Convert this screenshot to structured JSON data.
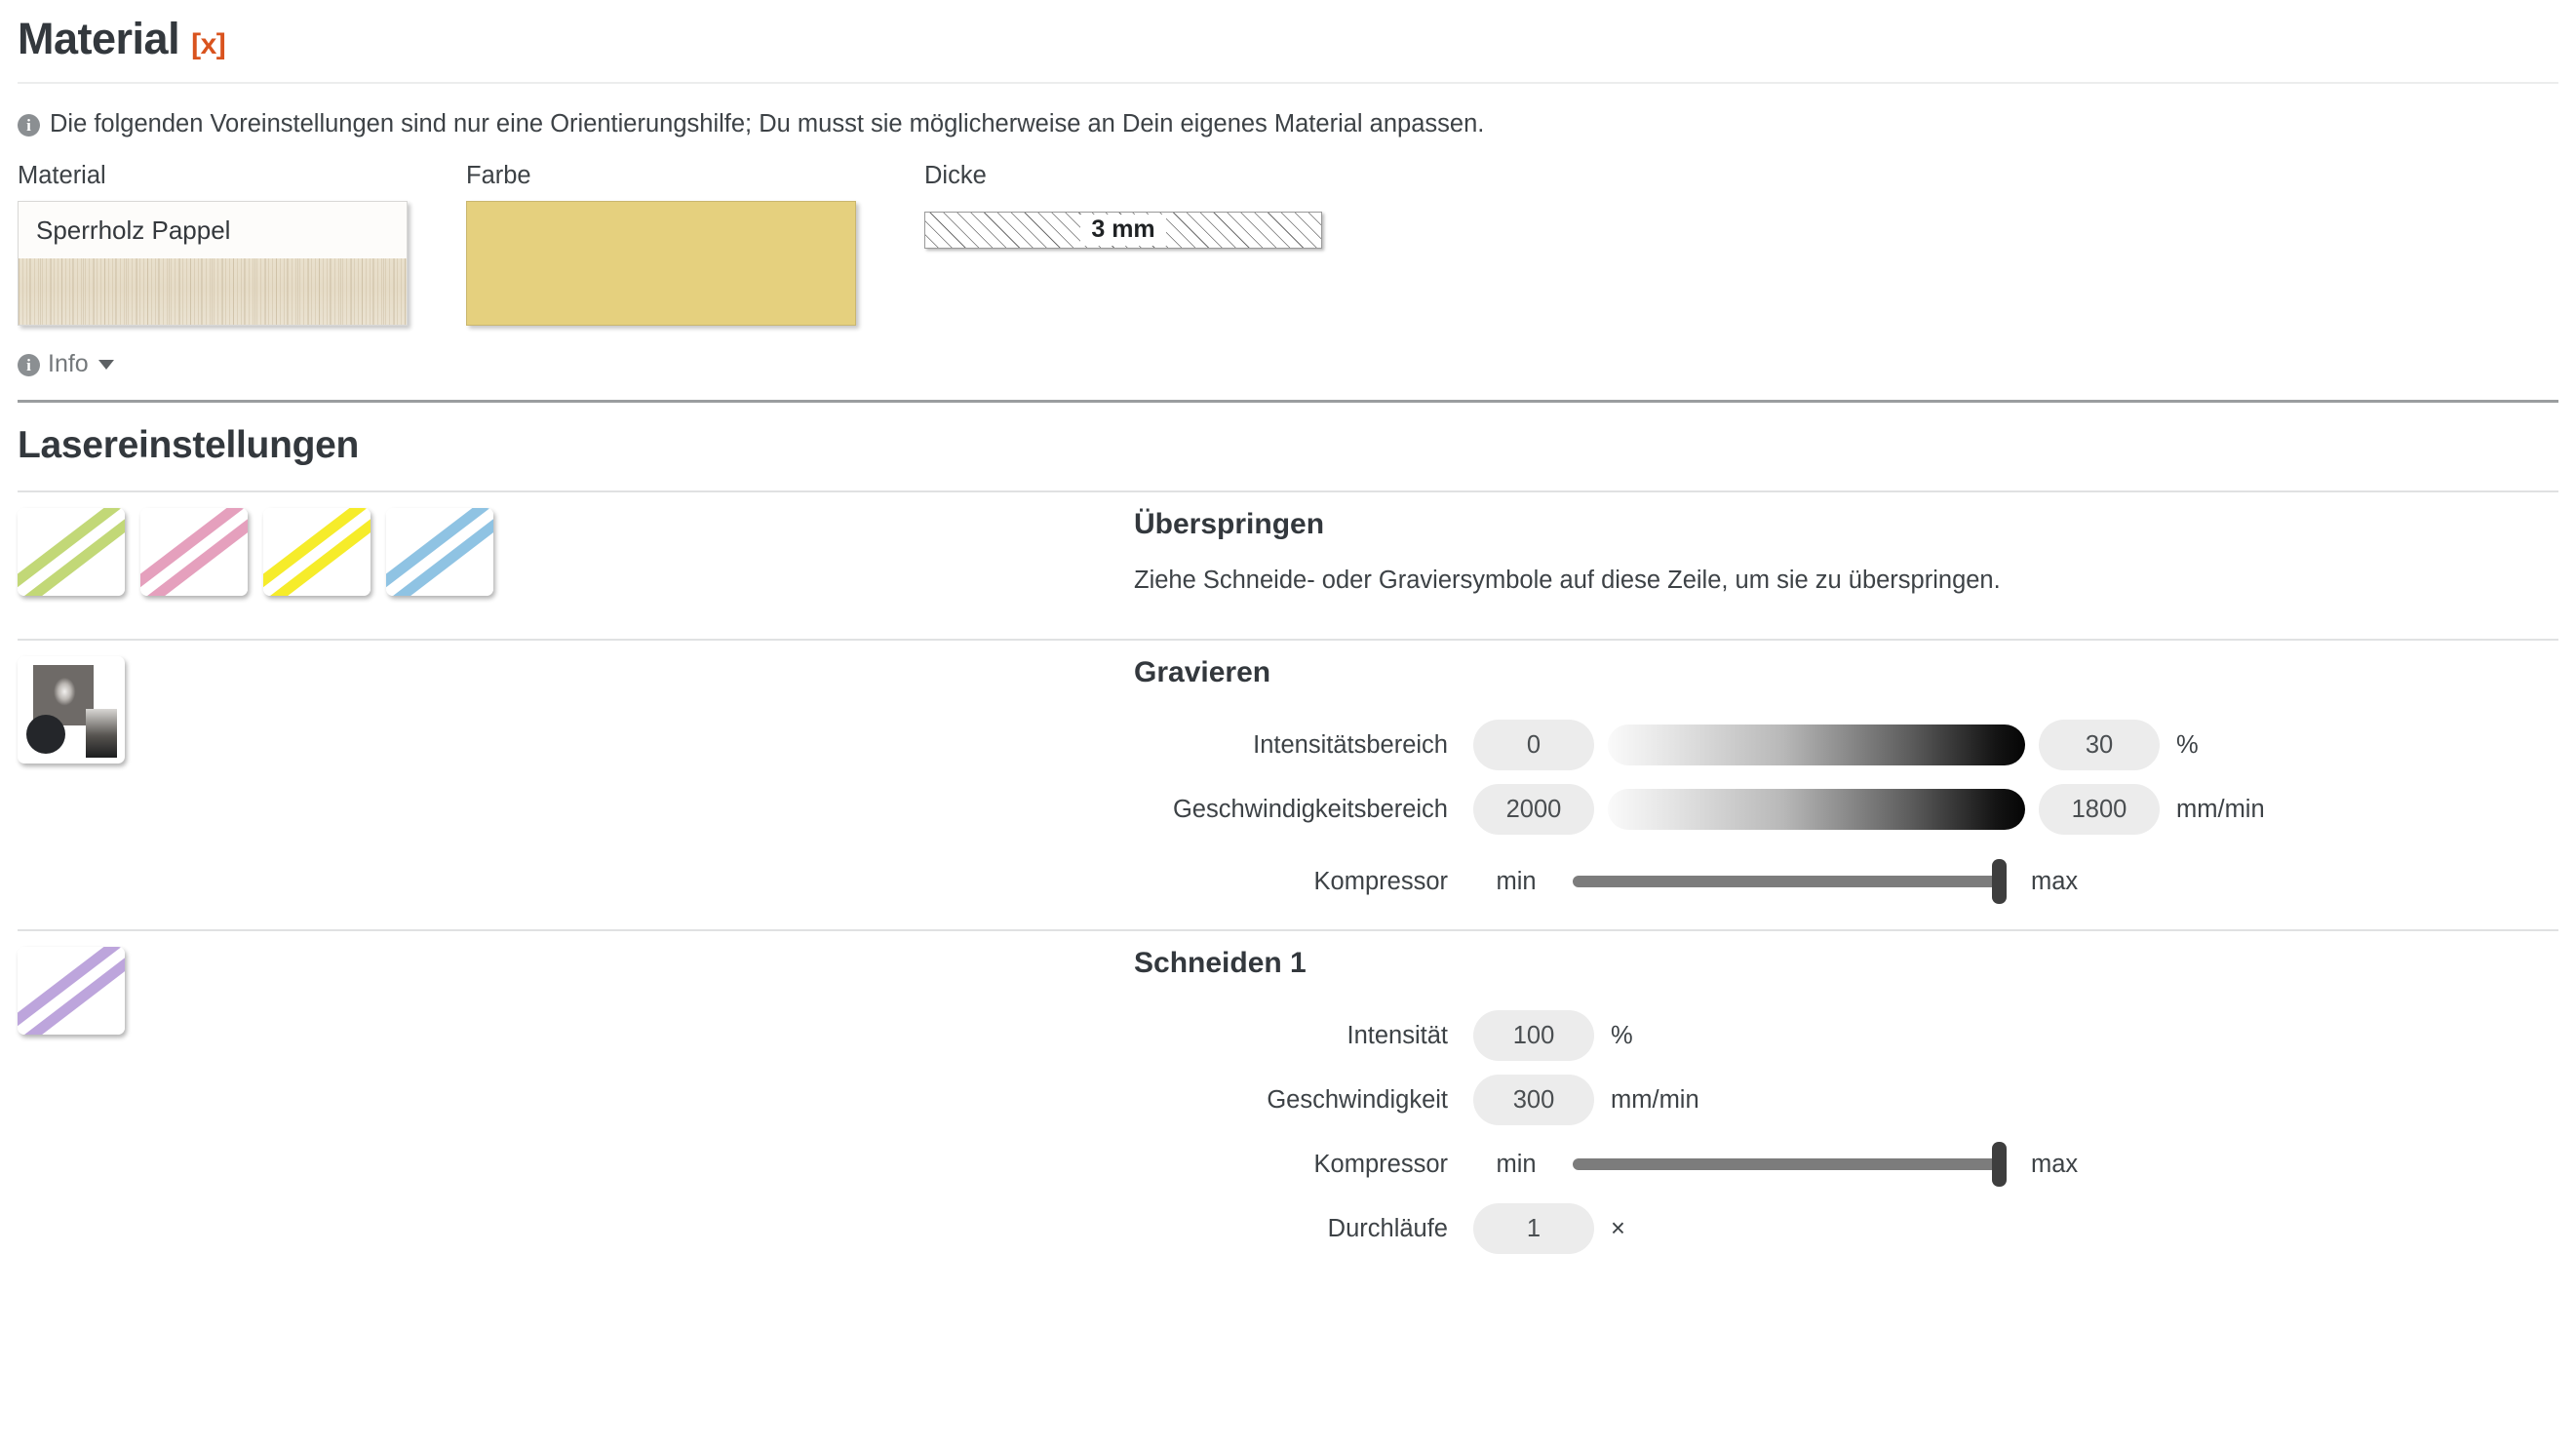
{
  "material_section": {
    "title": "Material",
    "close_label": "[x]",
    "notice": "Die folgenden Voreinstellungen sind nur eine Orientierungshilfe; Du musst sie möglicherweise an Dein eigenes Material anpassen.",
    "fields": {
      "material": {
        "label": "Material",
        "value": "Sperrholz Pappel"
      },
      "farbe": {
        "label": "Farbe",
        "color": "#e5d07e"
      },
      "dicke": {
        "label": "Dicke",
        "value": "3 mm"
      }
    },
    "info_toggle": "Info"
  },
  "laser_section": {
    "title": "Lasereinstellungen",
    "rows": [
      {
        "id": "ueberspringen",
        "title": "Überspringen",
        "description": "Ziehe Schneide- oder Graviersymbole auf diese Zeile, um sie zu überspringen.",
        "tiles": [
          {
            "name": "stripe-tile-green",
            "color": "#c2d877"
          },
          {
            "name": "stripe-tile-pink",
            "color": "#e5a0bd"
          },
          {
            "name": "stripe-tile-yellow",
            "color": "#f6ec2a"
          },
          {
            "name": "stripe-tile-blue",
            "color": "#8fc3e3"
          }
        ]
      },
      {
        "id": "gravieren",
        "title": "Gravieren",
        "params": [
          {
            "label": "Intensitätsbereich",
            "from": "0",
            "to": "30",
            "unit": "%",
            "control": "gradient"
          },
          {
            "label": "Geschwindigkeitsbereich",
            "from": "2000",
            "to": "1800",
            "unit": "mm/min",
            "control": "gradient"
          },
          {
            "label": "Kompressor",
            "min": "min",
            "max": "max",
            "control": "slider",
            "position_pct": 97
          }
        ]
      },
      {
        "id": "schneiden-1",
        "title": "Schneiden 1",
        "tile_color": "#bda5dc",
        "params": [
          {
            "label": "Intensität",
            "value": "100",
            "unit": "%",
            "control": "pill"
          },
          {
            "label": "Geschwindigkeit",
            "value": "300",
            "unit": "mm/min",
            "control": "pill"
          },
          {
            "label": "Kompressor",
            "min": "min",
            "max": "max",
            "control": "slider",
            "position_pct": 97
          },
          {
            "label": "Durchläufe",
            "value": "1",
            "unit": "×",
            "control": "pill"
          }
        ]
      }
    ]
  }
}
